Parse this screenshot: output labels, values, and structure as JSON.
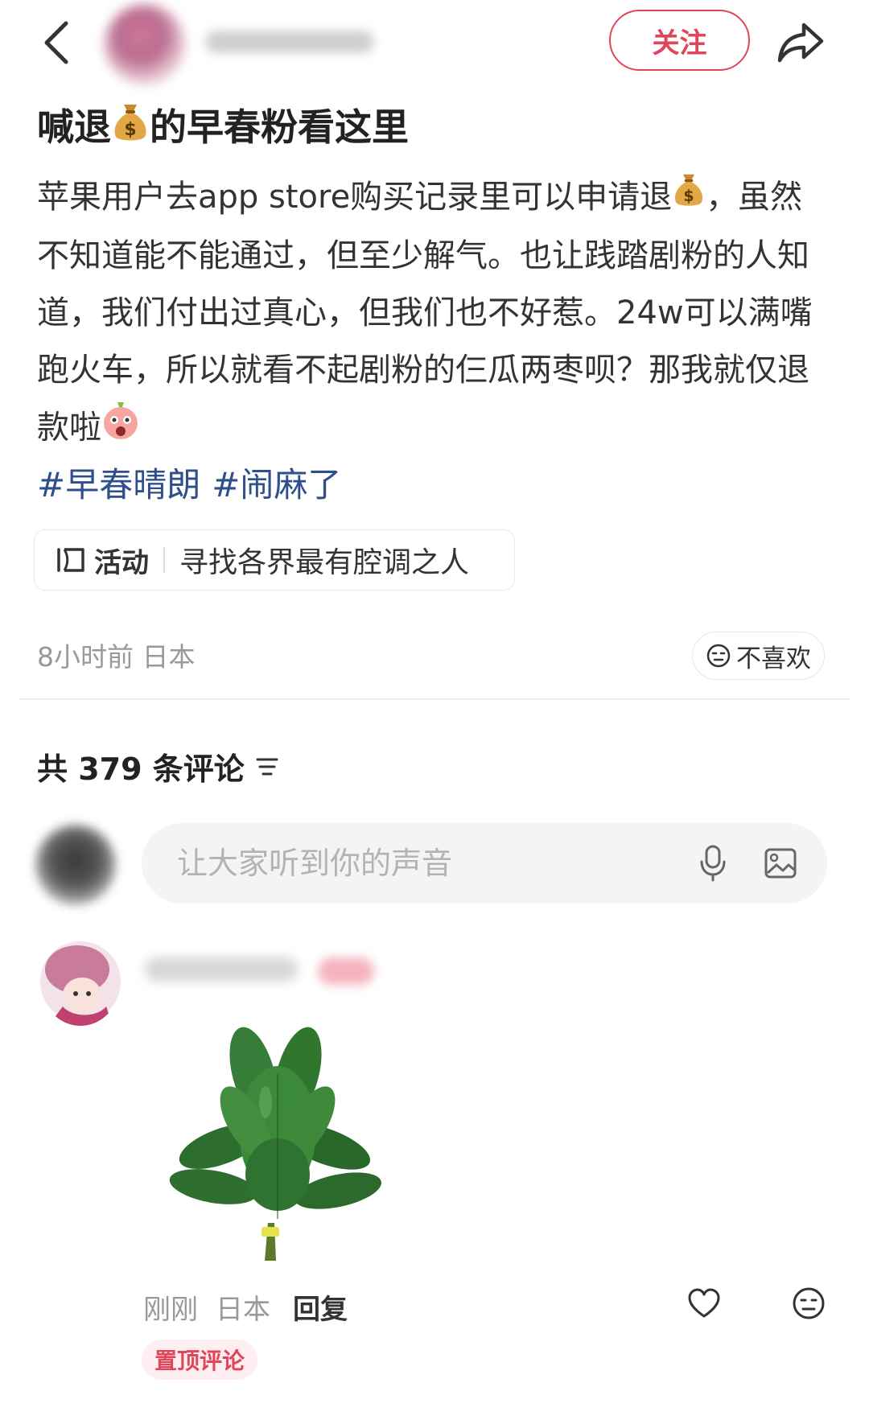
{
  "header": {
    "follow_label": "关注"
  },
  "post": {
    "title_part1": "喊退",
    "title_part2": "的早春粉看这里",
    "body_part1": "苹果用户去app store购买记录里可以申请退",
    "body_part2": "，虽然不知道能不能通过，但至少解气。也让践踏剧粉的人知道，我们付出过真心，但我们也不好惹。24w可以满嘴跑火车，所以就看不起剧粉的仨瓜两枣呗？那我就仅退款啦",
    "hashtags": [
      "#早春晴朗",
      "#闹麻了"
    ],
    "activity": {
      "tag": "活动",
      "text": "寻找各界最有腔调之人"
    },
    "time": "8小时前",
    "location": "日本",
    "dislike_label": "不喜欢"
  },
  "comments": {
    "count_label": "共 379 条评论",
    "input_placeholder": "让大家听到你的声音",
    "items": [
      {
        "time": "刚刚",
        "location": "日本",
        "reply_label": "回复",
        "pinned_label": "置顶评论"
      }
    ]
  },
  "colors": {
    "accent": "#e0455a",
    "hashtag": "#2e4f8c",
    "muted": "#999999"
  },
  "icons": [
    "back-arrow-icon",
    "share-icon",
    "money-bag-icon",
    "shocked-face-emoji-icon",
    "activity-icon",
    "neutral-face-icon",
    "sort-icon",
    "microphone-icon",
    "image-icon",
    "heart-icon",
    "emoji-reaction-icon"
  ]
}
